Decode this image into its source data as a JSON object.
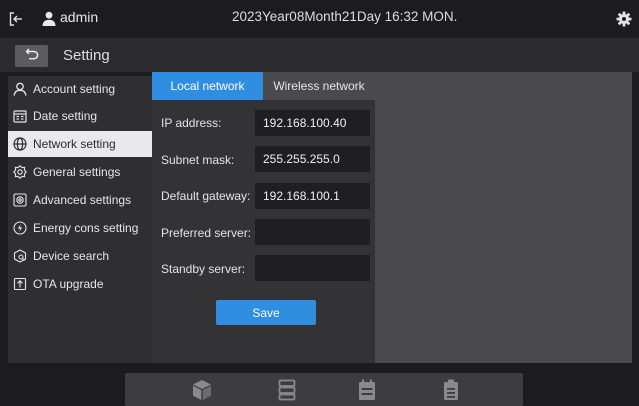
{
  "header": {
    "username": "admin",
    "datetime": "2023Year08Month21Day 16:32 MON."
  },
  "titlebar": {
    "title": "Setting"
  },
  "sidebar": {
    "items": [
      {
        "label": "Account setting",
        "icon": "user-outline-icon"
      },
      {
        "label": "Date setting",
        "icon": "calendar-icon"
      },
      {
        "label": "Network setting",
        "icon": "globe-icon",
        "active": true
      },
      {
        "label": "General settings",
        "icon": "gear-icon"
      },
      {
        "label": "Advanced settings",
        "icon": "advanced-settings-icon"
      },
      {
        "label": "Energy cons setting",
        "icon": "energy-icon"
      },
      {
        "label": "Device search",
        "icon": "device-search-icon"
      },
      {
        "label": "OTA upgrade",
        "icon": "upgrade-icon"
      }
    ]
  },
  "tabs": {
    "local": "Local network",
    "wireless": "Wireless network"
  },
  "form": {
    "ip_label": "IP address:",
    "ip_value": "192.168.100.40",
    "subnet_label": "Subnet mask:",
    "subnet_value": "255.255.255.0",
    "gateway_label": "Default gateway:",
    "gateway_value": "192.168.100.1",
    "preferred_label": "Preferred server:",
    "preferred_value": "",
    "standby_label": "Standby server:",
    "standby_value": "",
    "save_label": "Save"
  },
  "dock": {
    "items": [
      "cube-icon",
      "list-icon",
      "schedule-icon",
      "clipboard-icon"
    ]
  },
  "colors": {
    "accent": "#2f8ee0",
    "background": "#1c1c1e",
    "panel": "#333335"
  }
}
